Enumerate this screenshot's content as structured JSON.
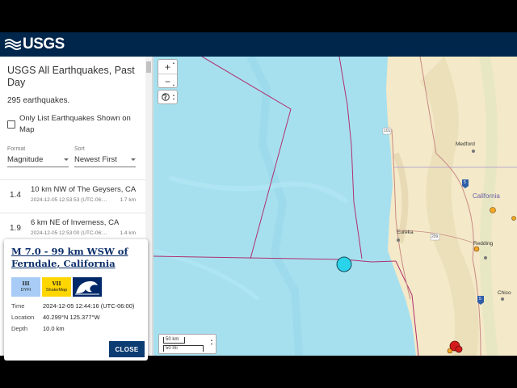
{
  "header": {
    "logo_text": "USGS",
    "logo_icon": "usgs-wave-icon",
    "bg_color": "#00264c"
  },
  "sidebar": {
    "title": "USGS All Earthquakes, Past Day",
    "count": "295 earthquakes.",
    "checkbox_label": "Only List Earthquakes Shown on Map",
    "format": {
      "label": "Format",
      "value": "Magnitude"
    },
    "sort": {
      "label": "Sort",
      "value": "Newest First"
    },
    "items": [
      {
        "mag": "1.4",
        "place": "10 km NW of The Geysers, CA",
        "time": "2024-12-05 12:53:53 (UTC-06:...",
        "depth": "1.7 km"
      },
      {
        "mag": "1.9",
        "place": "6 km NE of Inverness, CA",
        "time": "2024-12-05 12:53:00 (UTC-06:...",
        "depth": "1.4 km"
      }
    ]
  },
  "popup": {
    "title": "M 7.0 - 99 km WSW of Ferndale, California",
    "dyfi": {
      "intensity": "III",
      "label": "DYFI",
      "color": "#a8ccf5"
    },
    "shakemap": {
      "intensity": "VII",
      "label": "ShakeMap",
      "color": "#ffd600"
    },
    "tsunami_icon": "tsunami-icon",
    "time_label": "Time",
    "time_value": "2024-12-05 12:44:16 (UTC-06:00)",
    "location_label": "Location",
    "location_value": "40.299°N 125.377°W",
    "depth_label": "Depth",
    "depth_value": "10.0 km",
    "close_label": "CLOSE"
  },
  "map": {
    "labels": {
      "medford": "Medford",
      "california": "California",
      "eureka": "Eureka",
      "redding": "Redding",
      "chico": "Chico",
      "hwy101": "101",
      "hwy299": "299",
      "hwy5a": "5",
      "hwy5b": "5"
    },
    "zoom_in": "+",
    "zoom_out": "−",
    "scale_km": "50 km",
    "scale_mi": "50 mi",
    "colors": {
      "ocean": "#a6e0ef",
      "land": "#f4e9c8",
      "quake_main": "#29d4ea",
      "quake_small": "#f5a623",
      "quake_red": "#d51c1c"
    }
  }
}
